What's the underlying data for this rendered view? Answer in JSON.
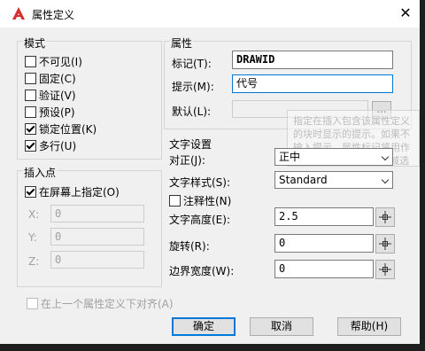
{
  "window": {
    "title": "属性定义",
    "close_glyph": "✕"
  },
  "mode": {
    "title": "模式",
    "options": [
      {
        "label": "不可见(I)",
        "checked": false
      },
      {
        "label": "固定(C)",
        "checked": false
      },
      {
        "label": "验证(V)",
        "checked": false
      },
      {
        "label": "预设(P)",
        "checked": false
      },
      {
        "label": "锁定位置(K)",
        "checked": true
      },
      {
        "label": "多行(U)",
        "checked": true
      }
    ]
  },
  "attribute": {
    "title": "属性",
    "tag_label": "标记(T):",
    "tag_value": "DRAWID",
    "prompt_label": "提示(M):",
    "prompt_value": "代号",
    "default_label": "默认(L):",
    "default_value": "",
    "browse_label": "..."
  },
  "tooltip": {
    "text": "指定在插入包含该属性定义的块时显示的提示。如果不输入提示，属性标记将用作提示。如果在\"模式\"区域选择\"固定\"模式，\"属性提示\"选项将不可用。"
  },
  "insertion": {
    "title": "插入点",
    "on_screen_label": "在屏幕上指定(O)",
    "on_screen_checked": true,
    "x_label": "X:",
    "x_value": "0",
    "y_label": "Y:",
    "y_value": "0",
    "z_label": "Z:",
    "z_value": "0"
  },
  "text_settings": {
    "title": "文字设置",
    "justify_label": "对正(J):",
    "justify_value": "正中",
    "style_label": "文字样式(S):",
    "style_value": "Standard",
    "annotative_label": "注释性(N)",
    "annotative_checked": false,
    "height_label": "文字高度(E):",
    "height_value": "2.5",
    "rotation_label": "旋转(R):",
    "rotation_value": "0",
    "width_label": "边界宽度(W):",
    "width_value": "0"
  },
  "align_below": {
    "label": "在上一个属性定义下对齐(A)",
    "checked": false
  },
  "buttons": {
    "ok": "确定",
    "cancel": "取消",
    "help": "帮助(H)"
  },
  "colors": {
    "accent": "#0078d7",
    "logo_red": "#d22f2f"
  }
}
